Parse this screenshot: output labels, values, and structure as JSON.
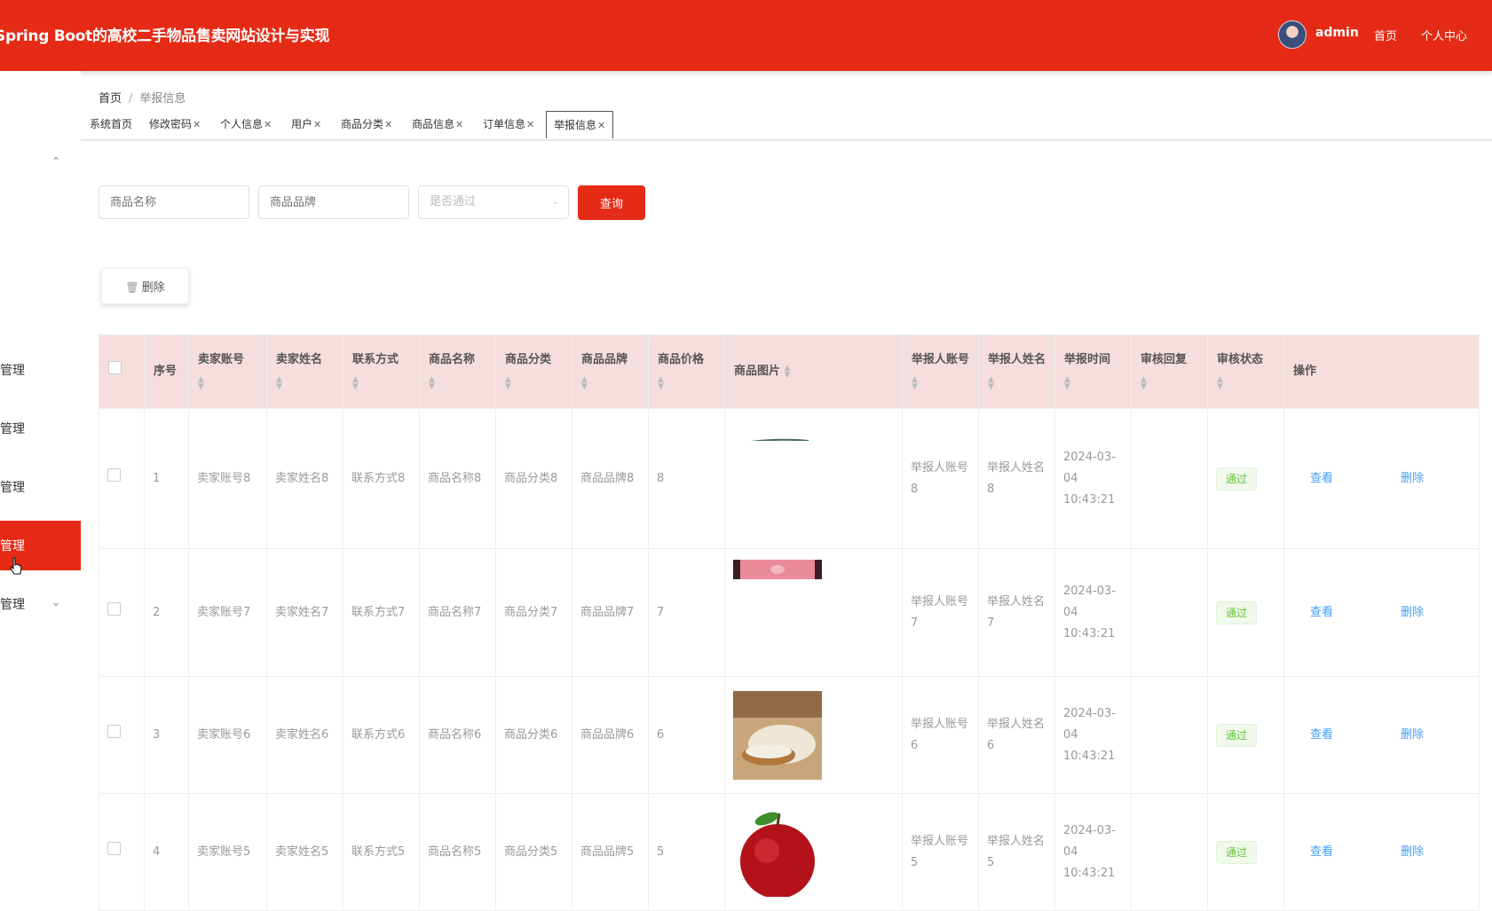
{
  "header": {
    "title": "Spring Boot的高校二手物品售卖网站设计与实现",
    "username": "admin",
    "nav_home": "首页",
    "nav_profile": "个人中心"
  },
  "colors": {
    "primary": "#e52b16",
    "header_bg": "#f7dede",
    "link": "#409eff",
    "success": "#67c23a"
  },
  "sidebar": {
    "items": [
      {
        "label": "管理",
        "active": false
      },
      {
        "label": "管理",
        "active": false
      },
      {
        "label": "管理",
        "active": false
      },
      {
        "label": "管理",
        "active": true
      },
      {
        "label": "管理",
        "active": false
      }
    ]
  },
  "breadcrumb": {
    "home": "首页",
    "sep": "/",
    "current": "举报信息"
  },
  "tabs": [
    {
      "label": "系统首页",
      "closable": false
    },
    {
      "label": "修改密码",
      "closable": true
    },
    {
      "label": "个人信息",
      "closable": true
    },
    {
      "label": "用户",
      "closable": true
    },
    {
      "label": "商品分类",
      "closable": true
    },
    {
      "label": "商品信息",
      "closable": true
    },
    {
      "label": "订单信息",
      "closable": true
    },
    {
      "label": "举报信息",
      "closable": true,
      "active": true
    }
  ],
  "search": {
    "name_placeholder": "商品名称",
    "brand_placeholder": "商品品牌",
    "pass_placeholder": "是否通过",
    "query_label": "查询"
  },
  "toolbar": {
    "delete_label": "删除"
  },
  "table": {
    "headers": {
      "index": "序号",
      "seller_account": "卖家账号",
      "seller_name": "卖家姓名",
      "contact": "联系方式",
      "goods_name": "商品名称",
      "goods_cat": "商品分类",
      "goods_brand": "商品品牌",
      "goods_price": "商品价格",
      "goods_image": "商品图片",
      "reporter_account": "举报人账号",
      "reporter_name": "举报人姓名",
      "report_time": "举报时间",
      "audit_reply": "审核回复",
      "audit_status": "审核状态",
      "ops": "操作"
    },
    "rows": [
      {
        "index": "1",
        "seller_account": "卖家账号8",
        "seller_name": "卖家姓名8",
        "contact": "联系方式8",
        "goods_name": "商品名称8",
        "goods_cat": "商品分类8",
        "goods_brand": "商品品牌8",
        "goods_price": "8",
        "image": "leaf-image",
        "reporter_account": "举报人账号8",
        "reporter_name": "举报人姓名8",
        "report_time": "2024-03-04 10:43:21",
        "audit_reply": "",
        "status": "通过",
        "view": "查看",
        "delete": "删除"
      },
      {
        "index": "2",
        "seller_account": "卖家账号7",
        "seller_name": "卖家姓名7",
        "contact": "联系方式7",
        "goods_name": "商品名称7",
        "goods_cat": "商品分类7",
        "goods_brand": "商品品牌7",
        "goods_price": "7",
        "image": "pink-gift-image",
        "reporter_account": "举报人账号7",
        "reporter_name": "举报人姓名7",
        "report_time": "2024-03-04 10:43:21",
        "audit_reply": "",
        "status": "通过",
        "view": "查看",
        "delete": "删除"
      },
      {
        "index": "3",
        "seller_account": "卖家账号6",
        "seller_name": "卖家姓名6",
        "contact": "联系方式6",
        "goods_name": "商品名称6",
        "goods_cat": "商品分类6",
        "goods_brand": "商品品牌6",
        "goods_price": "6",
        "image": "rice-image",
        "reporter_account": "举报人账号6",
        "reporter_name": "举报人姓名6",
        "report_time": "2024-03-04 10:43:21",
        "audit_reply": "",
        "status": "通过",
        "view": "查看",
        "delete": "删除"
      },
      {
        "index": "4",
        "seller_account": "卖家账号5",
        "seller_name": "卖家姓名5",
        "contact": "联系方式5",
        "goods_name": "商品名称5",
        "goods_cat": "商品分类5",
        "goods_brand": "商品品牌5",
        "goods_price": "5",
        "image": "apple-image",
        "reporter_account": "举报人账号5",
        "reporter_name": "举报人姓名5",
        "report_time": "2024-03-04 10:43:21",
        "audit_reply": "",
        "status": "通过",
        "view": "查看",
        "delete": "删除"
      }
    ]
  }
}
